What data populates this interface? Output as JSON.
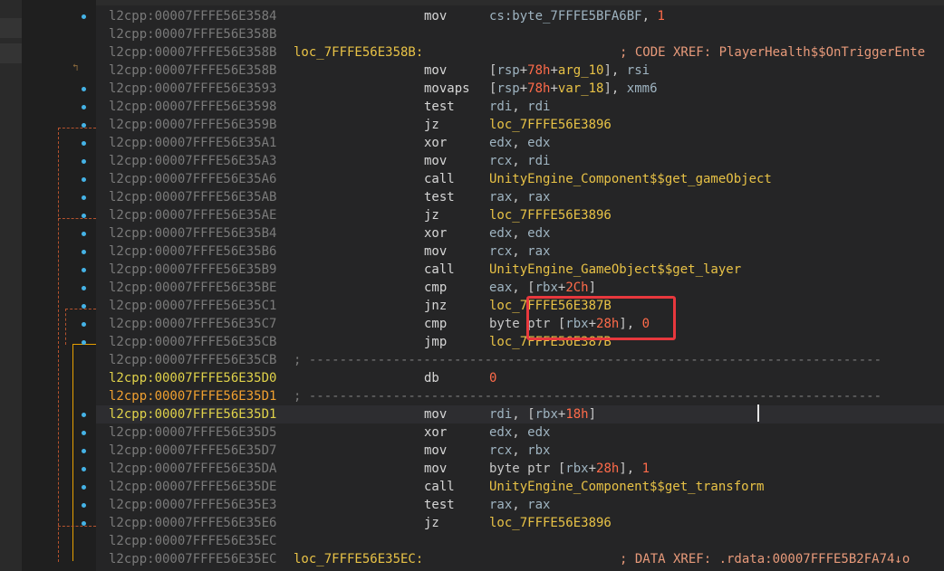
{
  "lines": [
    {
      "seg": "l2cpp:",
      "addr": "00007FFFE56E3584",
      "label": "",
      "mnem": "mov",
      "ops": [
        {
          "t": "reg",
          "v": "cs:byte_7FFFE5BFA6BF"
        },
        {
          "t": "kw",
          "v": ", "
        },
        {
          "t": "num",
          "v": "1"
        }
      ],
      "comment": "",
      "dot": true
    },
    {
      "seg": "l2cpp:",
      "addr": "00007FFFE56E358B",
      "label": "",
      "mnem": "",
      "ops": [],
      "comment": "",
      "dot": false
    },
    {
      "seg": "l2cpp:",
      "addr": "00007FFFE56E358B",
      "label": "loc_7FFFE56E358B:",
      "mnem": "",
      "ops": [],
      "comment": "; CODE XREF: PlayerHealth$$OnTriggerEnte",
      "dot": false
    },
    {
      "seg": "l2cpp:",
      "addr": "00007FFFE56E358B",
      "label": "",
      "mnem": "mov",
      "ops": [
        {
          "t": "kw",
          "v": "["
        },
        {
          "t": "reg",
          "v": "rsp"
        },
        {
          "t": "kw",
          "v": "+"
        },
        {
          "t": "num",
          "v": "78h"
        },
        {
          "t": "kw",
          "v": "+"
        },
        {
          "t": "sym",
          "v": "arg_10"
        },
        {
          "t": "kw",
          "v": "], "
        },
        {
          "t": "reg",
          "v": "rsi"
        }
      ],
      "comment": "",
      "dot": false
    },
    {
      "seg": "l2cpp:",
      "addr": "00007FFFE56E3593",
      "label": "",
      "mnem": "movaps",
      "ops": [
        {
          "t": "kw",
          "v": "["
        },
        {
          "t": "reg",
          "v": "rsp"
        },
        {
          "t": "kw",
          "v": "+"
        },
        {
          "t": "num",
          "v": "78h"
        },
        {
          "t": "kw",
          "v": "+"
        },
        {
          "t": "sym",
          "v": "var_18"
        },
        {
          "t": "kw",
          "v": "], "
        },
        {
          "t": "reg",
          "v": "xmm6"
        }
      ],
      "comment": "",
      "dot": true
    },
    {
      "seg": "l2cpp:",
      "addr": "00007FFFE56E3598",
      "label": "",
      "mnem": "test",
      "ops": [
        {
          "t": "reg",
          "v": "rdi"
        },
        {
          "t": "kw",
          "v": ", "
        },
        {
          "t": "reg",
          "v": "rdi"
        }
      ],
      "comment": "",
      "dot": true
    },
    {
      "seg": "l2cpp:",
      "addr": "00007FFFE56E359B",
      "label": "",
      "mnem": "jz",
      "ops": [
        {
          "t": "sym",
          "v": "loc_7FFFE56E3896"
        }
      ],
      "comment": "",
      "dot": true
    },
    {
      "seg": "l2cpp:",
      "addr": "00007FFFE56E35A1",
      "label": "",
      "mnem": "xor",
      "ops": [
        {
          "t": "reg",
          "v": "edx"
        },
        {
          "t": "kw",
          "v": ", "
        },
        {
          "t": "reg",
          "v": "edx"
        }
      ],
      "comment": "",
      "dot": true
    },
    {
      "seg": "l2cpp:",
      "addr": "00007FFFE56E35A3",
      "label": "",
      "mnem": "mov",
      "ops": [
        {
          "t": "reg",
          "v": "rcx"
        },
        {
          "t": "kw",
          "v": ", "
        },
        {
          "t": "reg",
          "v": "rdi"
        }
      ],
      "comment": "",
      "dot": true
    },
    {
      "seg": "l2cpp:",
      "addr": "00007FFFE56E35A6",
      "label": "",
      "mnem": "call",
      "ops": [
        {
          "t": "sym",
          "v": "UnityEngine_Component$$get_gameObject"
        }
      ],
      "comment": "",
      "dot": true
    },
    {
      "seg": "l2cpp:",
      "addr": "00007FFFE56E35AB",
      "label": "",
      "mnem": "test",
      "ops": [
        {
          "t": "reg",
          "v": "rax"
        },
        {
          "t": "kw",
          "v": ", "
        },
        {
          "t": "reg",
          "v": "rax"
        }
      ],
      "comment": "",
      "dot": true
    },
    {
      "seg": "l2cpp:",
      "addr": "00007FFFE56E35AE",
      "label": "",
      "mnem": "jz",
      "ops": [
        {
          "t": "sym",
          "v": "loc_7FFFE56E3896"
        }
      ],
      "comment": "",
      "dot": true
    },
    {
      "seg": "l2cpp:",
      "addr": "00007FFFE56E35B4",
      "label": "",
      "mnem": "xor",
      "ops": [
        {
          "t": "reg",
          "v": "edx"
        },
        {
          "t": "kw",
          "v": ", "
        },
        {
          "t": "reg",
          "v": "edx"
        }
      ],
      "comment": "",
      "dot": true
    },
    {
      "seg": "l2cpp:",
      "addr": "00007FFFE56E35B6",
      "label": "",
      "mnem": "mov",
      "ops": [
        {
          "t": "reg",
          "v": "rcx"
        },
        {
          "t": "kw",
          "v": ", "
        },
        {
          "t": "reg",
          "v": "rax"
        }
      ],
      "comment": "",
      "dot": true
    },
    {
      "seg": "l2cpp:",
      "addr": "00007FFFE56E35B9",
      "label": "",
      "mnem": "call",
      "ops": [
        {
          "t": "sym",
          "v": "UnityEngine_GameObject$$get_layer"
        }
      ],
      "comment": "",
      "dot": true
    },
    {
      "seg": "l2cpp:",
      "addr": "00007FFFE56E35BE",
      "label": "",
      "mnem": "cmp",
      "ops": [
        {
          "t": "reg",
          "v": "eax"
        },
        {
          "t": "kw",
          "v": ", ["
        },
        {
          "t": "reg",
          "v": "rbx"
        },
        {
          "t": "kw",
          "v": "+"
        },
        {
          "t": "num",
          "v": "2Ch"
        },
        {
          "t": "kw",
          "v": "]"
        }
      ],
      "comment": "",
      "dot": true
    },
    {
      "seg": "l2cpp:",
      "addr": "00007FFFE56E35C1",
      "label": "",
      "mnem": "jnz",
      "ops": [
        {
          "t": "sym",
          "v": "loc_7FFFE56E387B"
        }
      ],
      "comment": "",
      "dot": true
    },
    {
      "seg": "l2cpp:",
      "addr": "00007FFFE56E35C7",
      "label": "",
      "mnem": "cmp",
      "ops": [
        {
          "t": "kw",
          "v": "byte ptr ["
        },
        {
          "t": "reg",
          "v": "rbx"
        },
        {
          "t": "kw",
          "v": "+"
        },
        {
          "t": "num",
          "v": "28h"
        },
        {
          "t": "kw",
          "v": "], "
        },
        {
          "t": "num",
          "v": "0"
        }
      ],
      "comment": "",
      "dot": true
    },
    {
      "seg": "l2cpp:",
      "addr": "00007FFFE56E35CB",
      "label": "",
      "mnem": "jmp",
      "ops": [
        {
          "t": "sym",
          "v": "loc_7FFFE56E387B"
        }
      ],
      "comment": "",
      "dot": true
    },
    {
      "seg": "l2cpp:",
      "addr": "00007FFFE56E35CB",
      "label": "",
      "mnem": "",
      "ops": [],
      "comment": "",
      "sep": "; ---------------------------------------------------------------------------",
      "dot": false
    },
    {
      "seg": "l2cpp:",
      "addr": "00007FFFE56E35D0",
      "label": "",
      "mnem": "db",
      "ops": [
        {
          "t": "num",
          "v": "0"
        }
      ],
      "comment": "",
      "dot": false,
      "hl": "hl"
    },
    {
      "seg": "l2cpp:",
      "addr": "00007FFFE56E35D1",
      "label": "",
      "mnem": "",
      "ops": [],
      "comment": "",
      "sep": "; ---------------------------------------------------------------------------",
      "dot": false,
      "hl": "hl2"
    },
    {
      "seg": "l2cpp:",
      "addr": "00007FFFE56E35D1",
      "label": "",
      "mnem": "mov",
      "ops": [
        {
          "t": "reg",
          "v": "rdi"
        },
        {
          "t": "kw",
          "v": ", ["
        },
        {
          "t": "reg",
          "v": "rbx"
        },
        {
          "t": "kw",
          "v": "+"
        },
        {
          "t": "num",
          "v": "18h"
        },
        {
          "t": "kw",
          "v": "]"
        }
      ],
      "comment": "",
      "dot": true,
      "hl": "hl",
      "current": true
    },
    {
      "seg": "l2cpp:",
      "addr": "00007FFFE56E35D5",
      "label": "",
      "mnem": "xor",
      "ops": [
        {
          "t": "reg",
          "v": "edx"
        },
        {
          "t": "kw",
          "v": ", "
        },
        {
          "t": "reg",
          "v": "edx"
        }
      ],
      "comment": "",
      "dot": true
    },
    {
      "seg": "l2cpp:",
      "addr": "00007FFFE56E35D7",
      "label": "",
      "mnem": "mov",
      "ops": [
        {
          "t": "reg",
          "v": "rcx"
        },
        {
          "t": "kw",
          "v": ", "
        },
        {
          "t": "reg",
          "v": "rbx"
        }
      ],
      "comment": "",
      "dot": true
    },
    {
      "seg": "l2cpp:",
      "addr": "00007FFFE56E35DA",
      "label": "",
      "mnem": "mov",
      "ops": [
        {
          "t": "kw",
          "v": "byte ptr ["
        },
        {
          "t": "reg",
          "v": "rbx"
        },
        {
          "t": "kw",
          "v": "+"
        },
        {
          "t": "num",
          "v": "28h"
        },
        {
          "t": "kw",
          "v": "], "
        },
        {
          "t": "num",
          "v": "1"
        }
      ],
      "comment": "",
      "dot": true
    },
    {
      "seg": "l2cpp:",
      "addr": "00007FFFE56E35DE",
      "label": "",
      "mnem": "call",
      "ops": [
        {
          "t": "sym",
          "v": "UnityEngine_Component$$get_transform"
        }
      ],
      "comment": "",
      "dot": true
    },
    {
      "seg": "l2cpp:",
      "addr": "00007FFFE56E35E3",
      "label": "",
      "mnem": "test",
      "ops": [
        {
          "t": "reg",
          "v": "rax"
        },
        {
          "t": "kw",
          "v": ", "
        },
        {
          "t": "reg",
          "v": "rax"
        }
      ],
      "comment": "",
      "dot": true
    },
    {
      "seg": "l2cpp:",
      "addr": "00007FFFE56E35E6",
      "label": "",
      "mnem": "jz",
      "ops": [
        {
          "t": "sym",
          "v": "loc_7FFFE56E3896"
        }
      ],
      "comment": "",
      "dot": true
    },
    {
      "seg": "l2cpp:",
      "addr": "00007FFFE56E35EC",
      "label": "",
      "mnem": "",
      "ops": [],
      "comment": "",
      "dot": false
    },
    {
      "seg": "l2cpp:",
      "addr": "00007FFFE56E35EC",
      "label": "loc_7FFFE56E35EC:",
      "mnem": "",
      "ops": [],
      "comment": "; DATA XREF: .rdata:00007FFFE5B2FA74↓o",
      "dot": false
    }
  ],
  "colors": {
    "background": "#252526",
    "address": "#7a7a7a",
    "label": "#e8c246",
    "number": "#ff6b4a",
    "comment": "#e89a7a",
    "highlight_box": "#e8383d",
    "flow_dot": "#45b3e6"
  },
  "icons": {
    "flow_dot": "breakpoint-dot-icon",
    "text_cursor": "text-caret-icon"
  }
}
